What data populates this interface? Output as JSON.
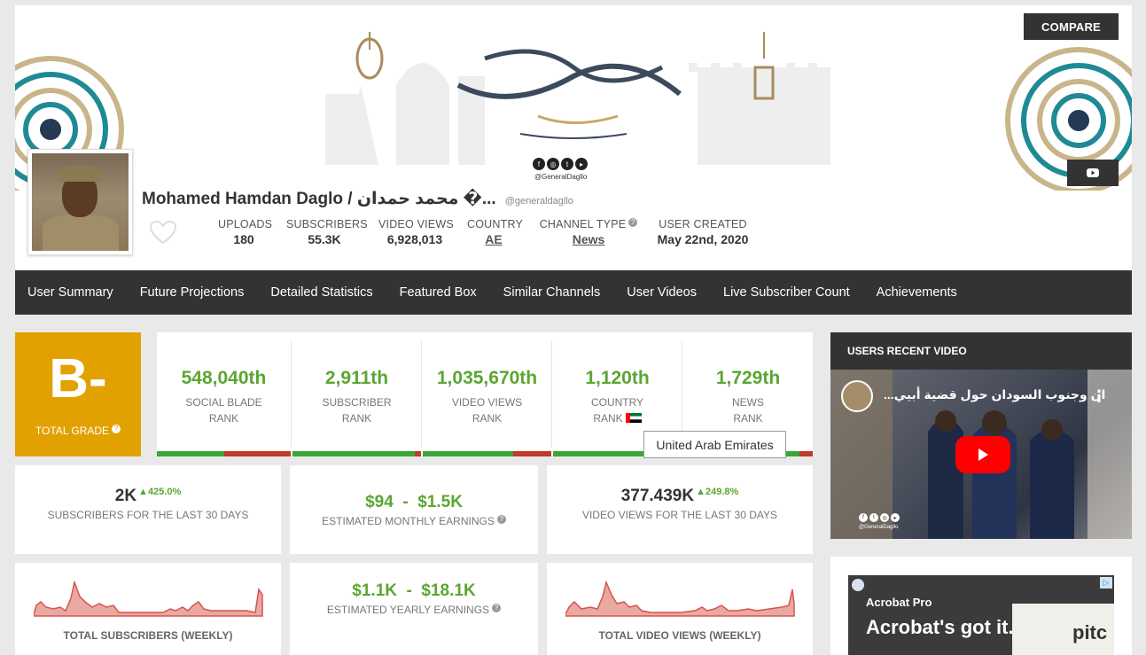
{
  "header": {
    "compare_label": "COMPARE",
    "channel_name": "Mohamed Hamdan Daglo / محمد حمدان �...",
    "channel_handle": "@generaldagllo",
    "banner_handle": "@GeneralDagllo",
    "stats": {
      "uploads": {
        "label": "UPLOADS",
        "value": "180"
      },
      "subscribers": {
        "label": "SUBSCRIBERS",
        "value": "55.3K"
      },
      "video_views": {
        "label": "VIDEO VIEWS",
        "value": "6,928,013"
      },
      "country": {
        "label": "COUNTRY",
        "value": "AE"
      },
      "channel_type": {
        "label": "CHANNEL TYPE",
        "value": "News"
      },
      "user_created": {
        "label": "USER CREATED",
        "value": "May 22nd, 2020"
      }
    }
  },
  "nav": {
    "items": [
      "User Summary",
      "Future Projections",
      "Detailed Statistics",
      "Featured Box",
      "Similar Channels",
      "User Videos",
      "Live Subscriber Count",
      "Achievements"
    ]
  },
  "grade": {
    "letter": "B-",
    "label": "TOTAL GRADE"
  },
  "ranks": [
    {
      "value": "548,040th",
      "line1": "SOCIAL BLADE",
      "line2": "RANK",
      "fill": 0.5
    },
    {
      "value": "2,911th",
      "line1": "SUBSCRIBER",
      "line2": "RANK",
      "fill": 0.95
    },
    {
      "value": "1,035,670th",
      "line1": "VIDEO VIEWS",
      "line2": "RANK",
      "fill": 0.7
    },
    {
      "value": "1,120th",
      "line1": "COUNTRY",
      "line2": "RANK",
      "fill": 0.9
    },
    {
      "value": "1,729th",
      "line1": "NEWS",
      "line2": "RANK",
      "fill": 0.9
    }
  ],
  "tooltip": "United Arab Emirates",
  "metrics": {
    "subs30": {
      "value": "2K",
      "pct": "425.0%",
      "label": "SUBSCRIBERS FOR THE LAST 30 DAYS"
    },
    "monthly": {
      "value": "$94  -  $1.5K",
      "label": "ESTIMATED MONTHLY EARNINGS"
    },
    "views30": {
      "value": "377.439K",
      "pct": "249.8%",
      "label": "VIDEO VIEWS FOR THE LAST 30 DAYS"
    },
    "yearly": {
      "value": "$1.1K  -  $18.1K",
      "label": "ESTIMATED YEARLY EARNINGS"
    },
    "total_subs_weekly": {
      "label": "TOTAL SUBSCRIBERS (WEEKLY)"
    },
    "total_views_weekly": {
      "label": "TOTAL VIDEO VIEWS (WEEKLY)"
    }
  },
  "recent_video": {
    "heading": "USERS RECENT VIDEO",
    "title": "...ان وجنوب السودان حول قضية أبيي",
    "handle": "@GeneralDagllo"
  },
  "ad": {
    "title": "Acrobat Pro",
    "text": "Acrobat's got it.",
    "image_text": "pitc"
  },
  "colors": {
    "grade": "#e1a100",
    "rank_green": "#5aa631",
    "bar_green": "#3aa636",
    "bar_red": "#c0392b",
    "nav_bg": "#333333",
    "spark": "#d9534f"
  }
}
